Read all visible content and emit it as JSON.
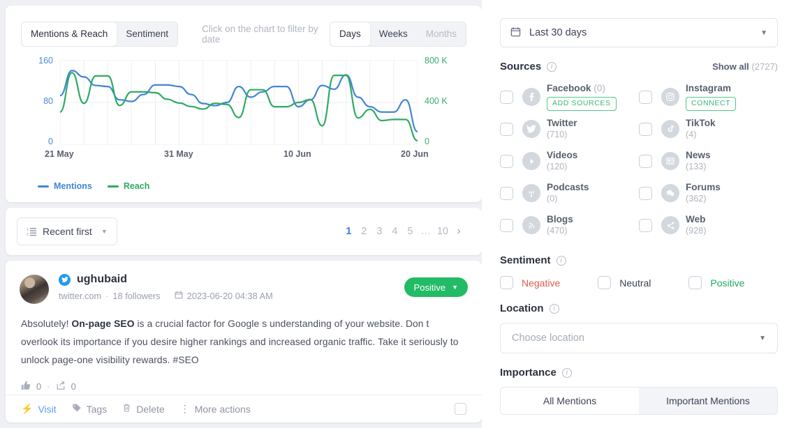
{
  "chart": {
    "tabs": [
      {
        "label": "Mentions & Reach",
        "active": true
      },
      {
        "label": "Sentiment",
        "active": false
      }
    ],
    "hint": "Click on the chart to filter by date",
    "granularity": [
      {
        "label": "Days",
        "state": "active"
      },
      {
        "label": "Weeks",
        "state": "normal"
      },
      {
        "label": "Months",
        "state": "disabled"
      }
    ],
    "legend": [
      {
        "label": "Mentions",
        "color": "#4285d6"
      },
      {
        "label": "Reach",
        "color": "#2eaa62"
      }
    ]
  },
  "chart_data": {
    "type": "line",
    "title": "",
    "xlabel": "",
    "ylabel": "Mentions",
    "y2label": "Reach",
    "grid": true,
    "legend_position": "bottom-left",
    "x_tick_labels": [
      "21 May",
      "31 May",
      "10 Jun",
      "20 Jun"
    ],
    "x": [
      "21 May",
      "22 May",
      "23 May",
      "24 May",
      "25 May",
      "26 May",
      "27 May",
      "28 May",
      "29 May",
      "30 May",
      "31 May",
      "1 Jun",
      "2 Jun",
      "3 Jun",
      "4 Jun",
      "5 Jun",
      "6 Jun",
      "7 Jun",
      "8 Jun",
      "9 Jun",
      "10 Jun",
      "11 Jun",
      "12 Jun",
      "13 Jun",
      "14 Jun",
      "15 Jun",
      "16 Jun",
      "17 Jun",
      "18 Jun",
      "19 Jun",
      "20 Jun"
    ],
    "ylim": [
      0,
      160
    ],
    "y_ticks": [
      0,
      80,
      160
    ],
    "y2lim": [
      0,
      800000
    ],
    "y2_ticks": [
      "0",
      "400 K",
      "800 K"
    ],
    "series": [
      {
        "name": "Mentions",
        "color": "#4285d6",
        "axis": "left",
        "values": [
          93,
          140,
          128,
          112,
          110,
          85,
          82,
          95,
          113,
          113,
          110,
          95,
          78,
          74,
          80,
          110,
          90,
          100,
          110,
          110,
          72,
          85,
          112,
          105,
          132,
          90,
          72,
          62,
          62,
          85,
          25
        ]
      },
      {
        "name": "Reach",
        "color": "#2eaa62",
        "axis": "right",
        "values": [
          310000,
          680000,
          392000,
          650000,
          650000,
          372000,
          500000,
          500000,
          492000,
          430000,
          395000,
          362000,
          338000,
          392000,
          382000,
          258000,
          520000,
          520000,
          360000,
          360000,
          400000,
          428000,
          180000,
          655000,
          655000,
          255000,
          335000,
          230000,
          240000,
          240000,
          40000
        ]
      }
    ]
  },
  "sort": {
    "label": "Recent first",
    "icon": "sort-list-icon"
  },
  "pagination": {
    "pages": [
      "1",
      "2",
      "3",
      "4",
      "5",
      "…",
      "10"
    ],
    "active": "1",
    "next_icon": "›"
  },
  "mention": {
    "author": "ughubaid",
    "verified_icon": "twitter-bird-icon",
    "domain": "twitter.com",
    "followers": "18 followers",
    "date": "2023-06-20 04:38 AM",
    "sentiment": "Positive",
    "body_before": "Absolutely! ",
    "body_bold": "On-page SEO",
    "body_after": " is a crucial factor for Google s understanding of your website. Don t overlook its importance if you desire higher rankings and increased organic traffic. Take it seriously to unlock page-one visibility rewards. #SEO",
    "likes": "0",
    "shares": "0",
    "actions": [
      {
        "label": "Visit",
        "icon": "lightning-icon",
        "accent": true
      },
      {
        "label": "Tags",
        "icon": "tag-icon",
        "accent": false
      },
      {
        "label": "Delete",
        "icon": "trash-icon",
        "accent": false
      },
      {
        "label": "More actions",
        "icon": "dots-vertical-icon",
        "accent": false
      }
    ]
  },
  "filters": {
    "date_range": {
      "value": "Last 30 days",
      "icon": "calendar-icon"
    },
    "sources": {
      "title": "Sources",
      "show_all_label": "Show all",
      "show_all_count": "(2727)",
      "items": [
        {
          "name": "Facebook",
          "count": "(0)",
          "inline_count": true,
          "icon": "facebook-icon",
          "pill": "ADD SOURCES"
        },
        {
          "name": "Instagram",
          "count": "",
          "inline_count": false,
          "icon": "instagram-icon",
          "pill": "CONNECT"
        },
        {
          "name": "Twitter",
          "count": "(710)",
          "inline_count": false,
          "icon": "twitter-icon",
          "pill": ""
        },
        {
          "name": "TikTok",
          "count": "(4)",
          "inline_count": false,
          "icon": "tiktok-icon",
          "pill": ""
        },
        {
          "name": "Videos",
          "count": "(120)",
          "inline_count": false,
          "icon": "play-icon",
          "pill": ""
        },
        {
          "name": "News",
          "count": "(133)",
          "inline_count": false,
          "icon": "newspaper-icon",
          "pill": ""
        },
        {
          "name": "Podcasts",
          "count": "(0)",
          "inline_count": false,
          "icon": "podcast-icon",
          "pill": ""
        },
        {
          "name": "Forums",
          "count": "(362)",
          "inline_count": false,
          "icon": "chat-bubbles-icon",
          "pill": ""
        },
        {
          "name": "Blogs",
          "count": "(470)",
          "inline_count": false,
          "icon": "rss-icon",
          "pill": ""
        },
        {
          "name": "Web",
          "count": "(928)",
          "inline_count": false,
          "icon": "share-nodes-icon",
          "pill": ""
        }
      ]
    },
    "sentiment": {
      "title": "Sentiment",
      "options": [
        {
          "label": "Negative",
          "color": "#e05a4f"
        },
        {
          "label": "Neutral",
          "color": "#3c4257"
        },
        {
          "label": "Positive",
          "color": "#22a95f"
        }
      ]
    },
    "location": {
      "title": "Location",
      "placeholder": "Choose location"
    },
    "importance": {
      "title": "Importance",
      "tabs": [
        {
          "label": "All Mentions",
          "active": true
        },
        {
          "label": "Important Mentions",
          "active": false
        }
      ]
    }
  }
}
